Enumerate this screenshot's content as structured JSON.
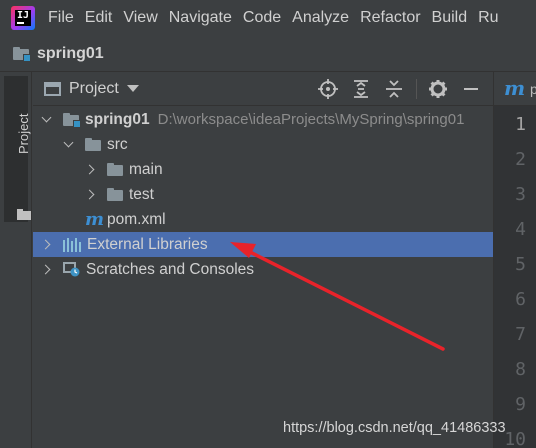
{
  "app": {
    "logo": "intellij-idea-logo"
  },
  "menu": {
    "items": [
      "File",
      "Edit",
      "View",
      "Navigate",
      "Code",
      "Analyze",
      "Refactor",
      "Build",
      "Ru"
    ]
  },
  "navbar": {
    "project_name": "spring01"
  },
  "left_strip": {
    "tab_label": "Project"
  },
  "panel": {
    "title": "Project",
    "toolbar_icons": [
      "locate-icon",
      "expand-all-icon",
      "collapse-all-icon",
      "gear-icon",
      "hide-icon"
    ]
  },
  "tree": {
    "root": {
      "name": "spring01",
      "path": "D:\\workspace\\ideaProjects\\MySpring\\spring01"
    },
    "src": "src",
    "main": "main",
    "test": "test",
    "pom": "pom.xml",
    "external_libraries": "External Libraries",
    "scratches": "Scratches and Consoles",
    "selected": "External Libraries"
  },
  "editor": {
    "tab_prefix": "p",
    "line_numbers": [
      "1",
      "2",
      "3",
      "4",
      "5",
      "6",
      "7",
      "8",
      "9",
      "10"
    ]
  },
  "colors": {
    "background": "#3c3f41",
    "selection": "#4b6eaf",
    "annotation_arrow": "#e8232a",
    "maven_blue": "#3d8fd3"
  },
  "watermark": "https://blog.csdn.net/qq_41486333"
}
